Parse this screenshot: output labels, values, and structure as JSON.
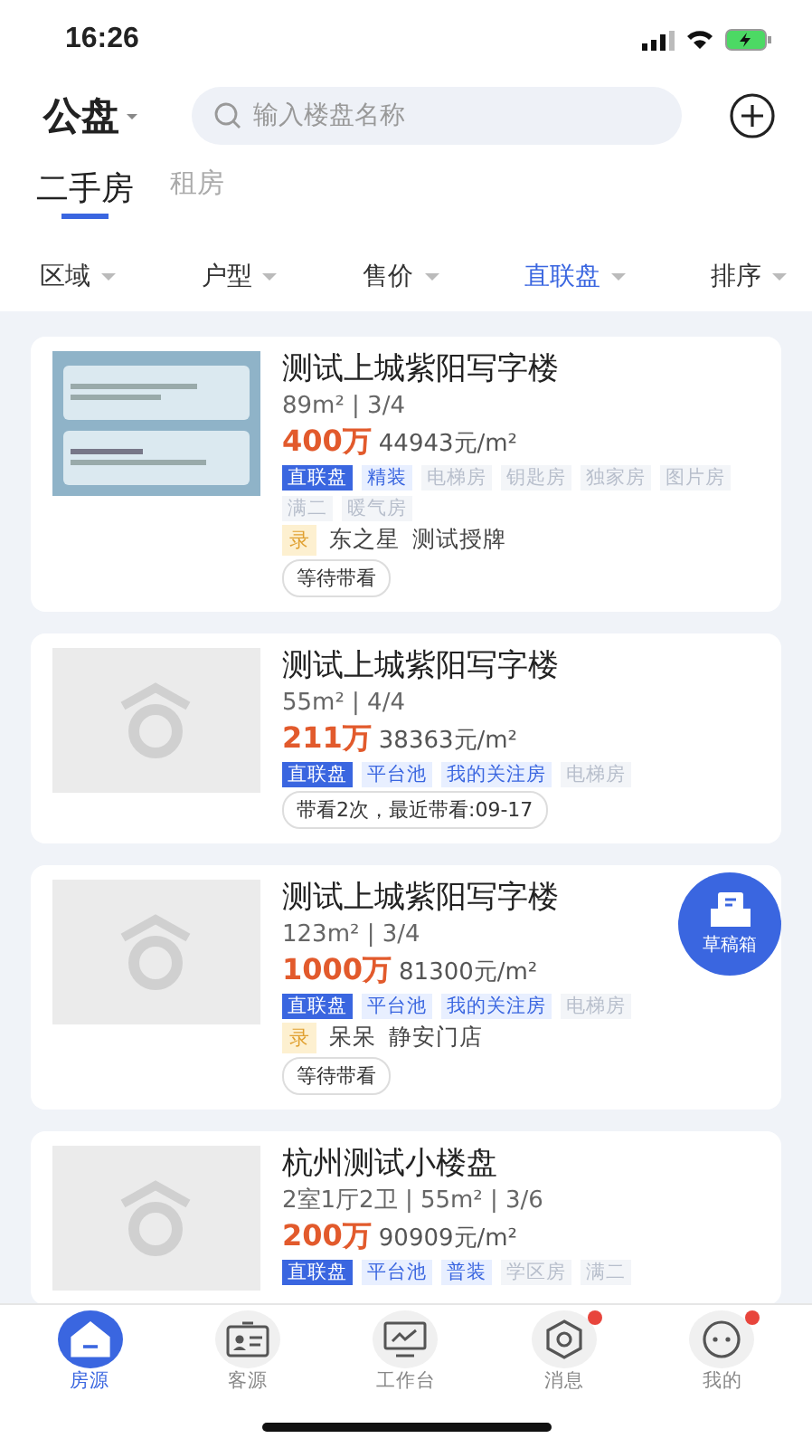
{
  "status_bar": {
    "time": "16:26"
  },
  "header": {
    "city": "公盘",
    "search": {
      "placeholder": "输入楼盘名称"
    }
  },
  "tabs": [
    {
      "label": "二手房",
      "selected": true
    },
    {
      "label": "租房",
      "selected": false
    }
  ],
  "filters": [
    {
      "label": "区域",
      "selected": false
    },
    {
      "label": "户型",
      "selected": false
    },
    {
      "label": "售价",
      "selected": false
    },
    {
      "label": "直联盘",
      "selected": true
    },
    {
      "label": "排序",
      "selected": false
    }
  ],
  "listings": [
    {
      "kind": "picture",
      "title": "测试上城紫阳写字楼",
      "specs": "89m² | 3/4",
      "price": "400万",
      "unit_price": "44943元/m²",
      "tags": [
        {
          "text": "直联盘",
          "kind": "solid"
        },
        {
          "text": "精装",
          "kind": "blue"
        },
        {
          "text": "电梯房",
          "kind": "grey"
        },
        {
          "text": "钥匙房",
          "kind": "grey"
        },
        {
          "text": "独家房",
          "kind": "grey"
        },
        {
          "text": "图片房",
          "kind": "grey"
        },
        {
          "text": "满二",
          "kind": "grey"
        },
        {
          "text": "暖气房",
          "kind": "grey"
        }
      ],
      "agent": {
        "badge": "录",
        "name": "东之星",
        "store": "测试授牌"
      },
      "status": "等待带看"
    },
    {
      "kind": "placeholder",
      "title": "测试上城紫阳写字楼",
      "specs": "55m² | 4/4",
      "price": "211万",
      "unit_price": "38363元/m²",
      "tags": [
        {
          "text": "直联盘",
          "kind": "solid"
        },
        {
          "text": "平台池",
          "kind": "blue"
        },
        {
          "text": "我的关注房",
          "kind": "blue"
        },
        {
          "text": "电梯房",
          "kind": "grey"
        }
      ],
      "status": "带看2次，最近带看:09-17"
    },
    {
      "kind": "placeholder",
      "title": "测试上城紫阳写字楼",
      "specs": "123m² | 3/4",
      "price": "1000万",
      "unit_price": "81300元/m²",
      "tags": [
        {
          "text": "直联盘",
          "kind": "solid"
        },
        {
          "text": "平台池",
          "kind": "blue"
        },
        {
          "text": "我的关注房",
          "kind": "blue"
        },
        {
          "text": "电梯房",
          "kind": "grey"
        }
      ],
      "agent": {
        "badge": "录",
        "name": "呆呆",
        "store": "静安门店"
      },
      "status": "等待带看"
    },
    {
      "kind": "placeholder",
      "title": "杭州测试小楼盘",
      "specs": "2室1厅2卫 | 55m² | 3/6",
      "price": "200万",
      "unit_price": "90909元/m²",
      "tags": [
        {
          "text": "直联盘",
          "kind": "solid"
        },
        {
          "text": "平台池",
          "kind": "blue"
        },
        {
          "text": "普装",
          "kind": "blue"
        },
        {
          "text": "学区房",
          "kind": "grey"
        },
        {
          "text": "满二",
          "kind": "grey"
        }
      ]
    }
  ],
  "floating_button": {
    "label": "草稿箱"
  },
  "bottom_nav": [
    {
      "label": "房源",
      "selected": true,
      "badge": false
    },
    {
      "label": "客源",
      "selected": false,
      "badge": false
    },
    {
      "label": "工作台",
      "selected": false,
      "badge": false
    },
    {
      "label": "消息",
      "selected": false,
      "badge": true
    },
    {
      "label": "我的",
      "selected": false,
      "badge": true
    }
  ]
}
